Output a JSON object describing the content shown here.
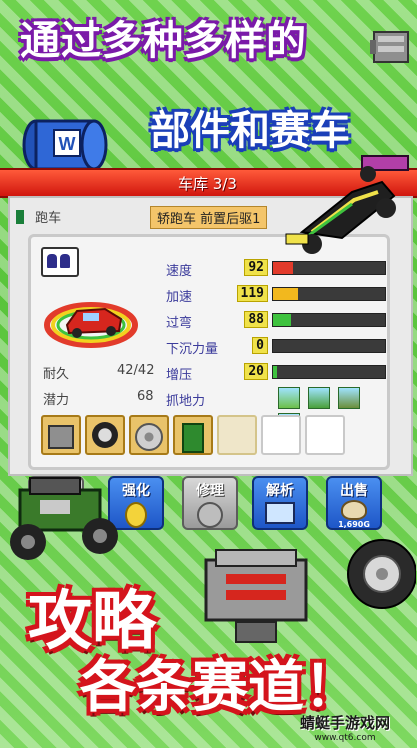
{
  "promo": {
    "headline_top": "通过多种多样的",
    "headline_mid": "部件和赛车",
    "headline_bottom_1": "攻略",
    "headline_bottom_2": "各条赛道！",
    "watermark": "蜻蜓手游戏网",
    "watermark_url": "www.qt6.com"
  },
  "garage": {
    "title": "车库 3/3",
    "car_class": "跑车",
    "car_type": "轿跑车 前置后驱1"
  },
  "stats": [
    {
      "name": "速度",
      "value": "92",
      "level": 0.18,
      "color": "#e23b2b"
    },
    {
      "name": "加速",
      "value": "119",
      "level": 0.22,
      "color": "#f2b81e"
    },
    {
      "name": "过弯",
      "value": "88",
      "level": 0.16,
      "color": "#3ec23e"
    },
    {
      "name": "下沉力量",
      "value": "0",
      "level": 0,
      "color": "#3ec23e"
    },
    {
      "name": "增压",
      "value": "20",
      "level": 0.04,
      "color": "#3ec23e"
    },
    {
      "name": "抓地力",
      "value": "",
      "level": 0,
      "color": "#3ec23e"
    }
  ],
  "durability": {
    "label": "耐久",
    "value": "42/42"
  },
  "potential": {
    "label": "潜力",
    "value": "68"
  },
  "actions": {
    "upgrade": "强化",
    "repair": "修理",
    "analyze": "解析",
    "sell": "出售",
    "sell_price": "1,690G"
  },
  "icons": [
    "helmet-pair-icon",
    "engine-part-icon",
    "tire-icon",
    "brake-disc-icon",
    "oil-can-icon",
    "grip-terrain-icons"
  ]
}
